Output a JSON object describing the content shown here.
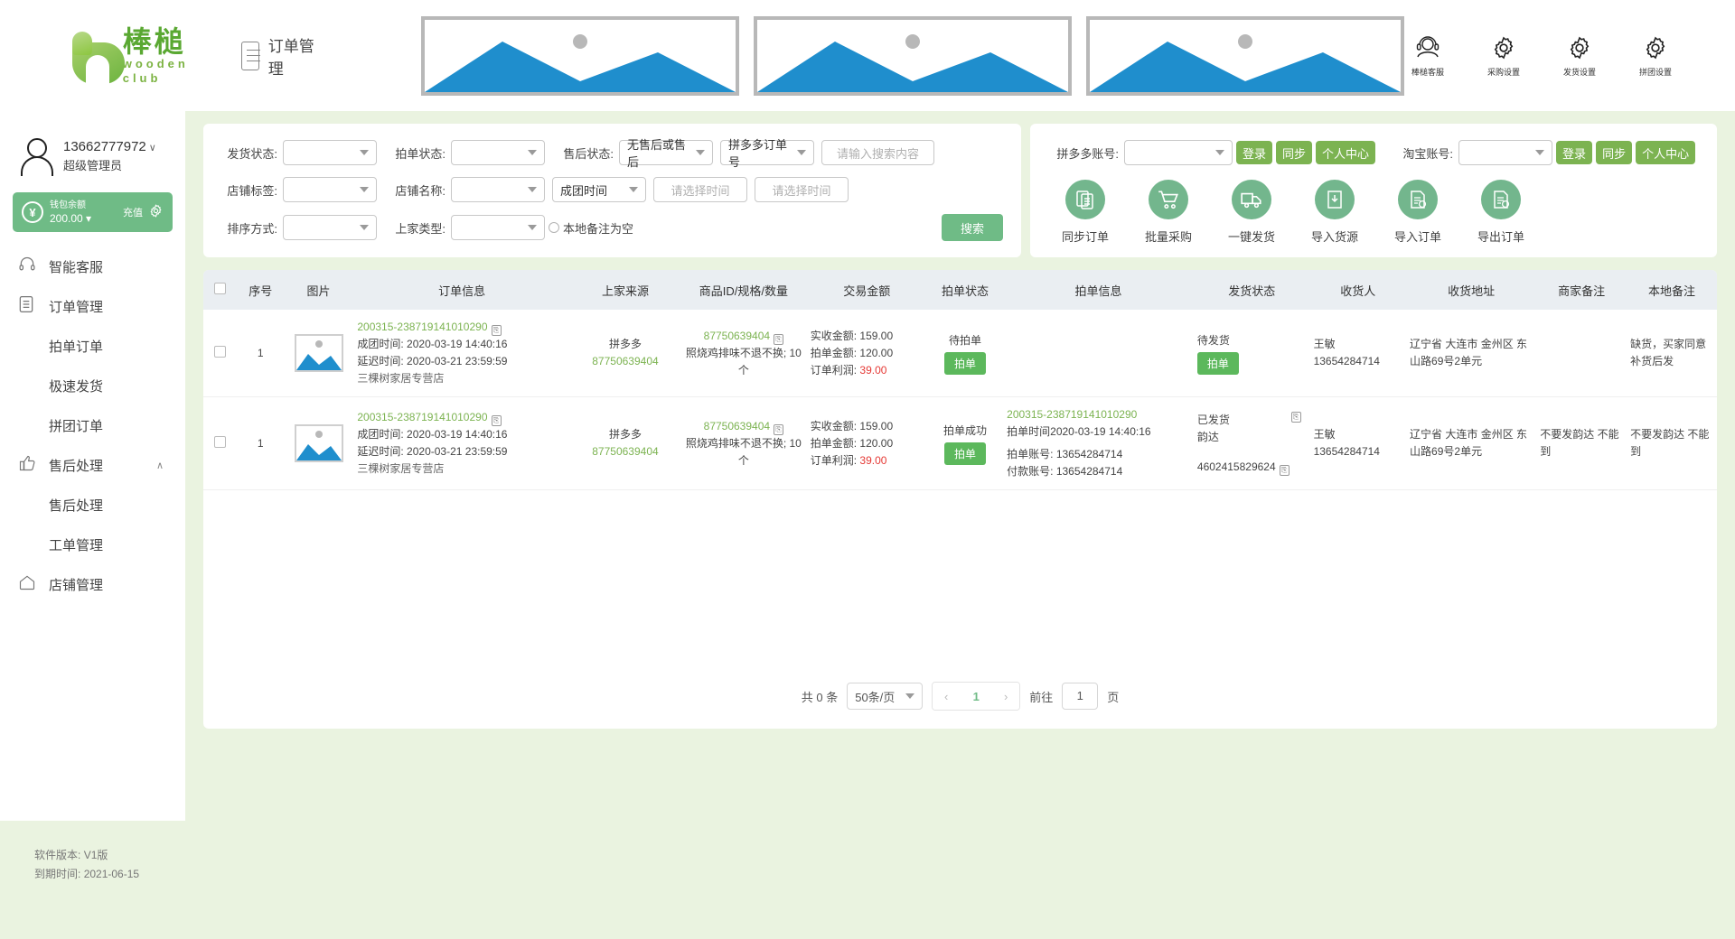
{
  "header": {
    "logo_cn": "棒槌",
    "logo_en": "wooden club",
    "page_title": "订单管理",
    "tools": [
      {
        "icon": "headset-user-icon",
        "label": "棒槌客服"
      },
      {
        "icon": "gear-icon",
        "label": "采购设置"
      },
      {
        "icon": "gear-icon",
        "label": "发货设置"
      },
      {
        "icon": "gear-icon",
        "label": "拼团设置"
      }
    ]
  },
  "sidebar": {
    "user": {
      "phone": "13662777972",
      "role": "超级管理员",
      "caret": "∨"
    },
    "wallet": {
      "title": "钱包余额",
      "amount": "200.00 ▾",
      "recharge": "充值"
    },
    "items": [
      {
        "label": "智能客服",
        "icon": "headset-icon",
        "sub": false
      },
      {
        "label": "订单管理",
        "icon": "doc-icon",
        "sub": false
      },
      {
        "label": "拍单订单",
        "icon": "",
        "sub": true
      },
      {
        "label": "极速发货",
        "icon": "",
        "sub": true
      },
      {
        "label": "拼团订单",
        "icon": "",
        "sub": true
      },
      {
        "label": "售后处理",
        "icon": "thumb-up-icon",
        "sub": false,
        "chevron": "∧"
      },
      {
        "label": "售后处理",
        "icon": "",
        "sub": true
      },
      {
        "label": "工单管理",
        "icon": "",
        "sub": true
      },
      {
        "label": "店铺管理",
        "icon": "home-icon",
        "sub": false
      }
    ]
  },
  "filters": {
    "row1": {
      "ship_status_label": "发货状态:",
      "ship_status_value": "",
      "order_status_label": "拍单状态:",
      "order_status_value": "",
      "after_sale_label": "售后状态:",
      "after_sale_value": "无售后或售后",
      "order_no_type_value": "拼多多订单号",
      "search_placeholder": "请输入搜索内容"
    },
    "row2": {
      "shop_tag_label": "店铺标签:",
      "shop_tag_value": "",
      "shop_name_label": "店铺名称:",
      "shop_name_value": "",
      "time_type_value": "成团时间",
      "time_from_placeholder": "请选择时间",
      "time_to_placeholder": "请选择时间"
    },
    "row3": {
      "sort_label": "排序方式:",
      "sort_value": "",
      "supplier_label": "上家类型:",
      "supplier_value": "",
      "radio_label": "本地备注为空",
      "search_button": "搜索"
    }
  },
  "accounts": {
    "pdd_label": "拼多多账号:",
    "pdd_value": "",
    "pdd_buttons": [
      "登录",
      "同步",
      "个人中心"
    ],
    "taobao_label": "淘宝账号:",
    "taobao_value": "",
    "taobao_buttons": [
      "登录",
      "同步",
      "个人中心"
    ],
    "actions": [
      {
        "icon": "sync-orders-icon",
        "label": "同步订单"
      },
      {
        "icon": "cart-icon",
        "label": "批量采购"
      },
      {
        "icon": "truck-icon",
        "label": "一键发货"
      },
      {
        "icon": "import-supply-icon",
        "label": "导入货源"
      },
      {
        "icon": "import-order-icon",
        "label": "导入订单"
      },
      {
        "icon": "export-order-icon",
        "label": "导出订单"
      }
    ]
  },
  "table": {
    "columns": [
      "",
      "序号",
      "图片",
      "订单信息",
      "上家来源",
      "商品ID/规格/数量",
      "交易金额",
      "拍单状态",
      "拍单信息",
      "发货状态",
      "收货人",
      "收货地址",
      "商家备注",
      "本地备注"
    ],
    "rows": [
      {
        "index": "1",
        "order_no": "200315-238719141010290",
        "group_time_label": "成团时间:",
        "group_time": "2020-03-19 14:40:16",
        "delay_time_label": "延迟时间:",
        "delay_time": "2020-03-21 23:59:59",
        "shop_name": "三棵树家居专营店",
        "source": "拼多多",
        "source_id": "87750639404",
        "goods_id": "87750639404",
        "goods_spec": "照烧鸡排味不退不换; 10个",
        "amount_recv_label": "实收金额:",
        "amount_recv": "159.00",
        "amount_buy_label": "拍单金额:",
        "amount_buy": "120.00",
        "profit_label": "订单利润:",
        "profit": "39.00",
        "order_status": "待拍单",
        "order_status_btn": "拍单",
        "buy_info": "",
        "ship_status": "待发货",
        "ship_btn": "拍单",
        "receiver_name": "王敏",
        "receiver_phone": "13654284714",
        "address": "辽宁省 大连市 金州区 东山路69号2单元",
        "merchant_note": "",
        "local_note": "缺货，买家同意补货后发"
      },
      {
        "index": "1",
        "order_no": "200315-238719141010290",
        "group_time_label": "成团时间:",
        "group_time": "2020-03-19 14:40:16",
        "delay_time_label": "延迟时间:",
        "delay_time": "2020-03-21 23:59:59",
        "shop_name": "三棵树家居专营店",
        "source": "拼多多",
        "source_id": "87750639404",
        "goods_id": "87750639404",
        "goods_spec": "照烧鸡排味不退不换; 10个",
        "amount_recv_label": "实收金额:",
        "amount_recv": "159.00",
        "amount_buy_label": "拍单金额:",
        "amount_buy": "120.00",
        "profit_label": "订单利润:",
        "profit": "39.00",
        "order_status": "拍单成功",
        "order_status_btn": "拍单",
        "buy_order_no": "200315-238719141010290",
        "buy_time_label": "拍单时间",
        "buy_time": "2020-03-19 14:40:16",
        "buy_account_label": "拍单账号:",
        "buy_account": "13654284714",
        "pay_account_label": "付款账号:",
        "pay_account": "13654284714",
        "ship_status": "已发货",
        "ship_company": "韵达",
        "ship_no": "4602415829624",
        "receiver_name": "王敏",
        "receiver_phone": "13654284714",
        "address": "辽宁省 大连市 金州区 东山路69号2单元",
        "merchant_note": "不要发韵达 不能到",
        "local_note": "不要发韵达 不能到"
      }
    ]
  },
  "pager": {
    "total": "共 0 条",
    "page_size": "50条/页",
    "prev": "‹",
    "current": "1",
    "next": "›",
    "goto_label": "前往",
    "goto_value": "1",
    "page_unit": "页"
  },
  "footer": {
    "version_label": "软件版本:",
    "version": "V1版",
    "expire_label": "到期时间:",
    "expire": "2021-06-15"
  },
  "colors": {
    "brand_green": "#7cb351",
    "accent_green": "#6fbb86",
    "bg": "#eaf3e0",
    "banner_blue": "#1f8ecd",
    "profit_red": "#e53935"
  }
}
